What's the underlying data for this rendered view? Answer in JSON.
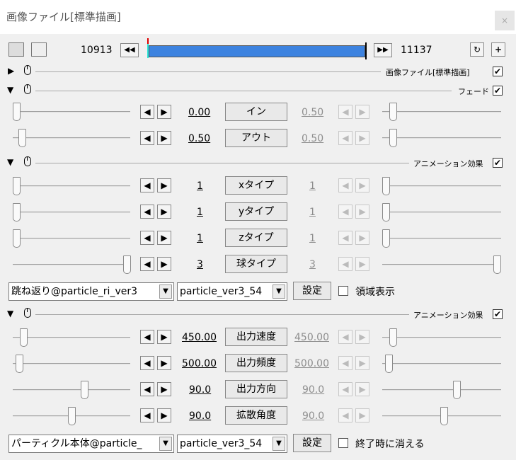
{
  "window": {
    "title": "画像ファイル[標準描画]",
    "close_icon": "close-icon"
  },
  "frames": {
    "start": "10913",
    "end": "11137"
  },
  "header_sections": [
    {
      "label": "画像ファイル[標準描画]",
      "checked": true
    }
  ],
  "fade_section": {
    "label": "フェード",
    "rows": [
      {
        "left": "0.00",
        "button": "イン",
        "right": "0.50"
      },
      {
        "left": "0.50",
        "button": "アウト",
        "right": "0.50"
      }
    ]
  },
  "anim1": {
    "label": "アニメーション効果",
    "rows": [
      {
        "left": "1",
        "button": "xタイプ",
        "right": "1"
      },
      {
        "left": "1",
        "button": "yタイプ",
        "right": "1"
      },
      {
        "left": "1",
        "button": "zタイプ",
        "right": "1"
      },
      {
        "left": "3",
        "button": "球タイプ",
        "right": "3"
      }
    ],
    "select1": "跳ね返り@particle_ri_ver3",
    "select2": "particle_ver3_54",
    "settings_button": "設定",
    "checkbox_label": "領域表示"
  },
  "anim2": {
    "label": "アニメーション効果",
    "rows": [
      {
        "left": "450.00",
        "button": "出力速度",
        "right": "450.00"
      },
      {
        "left": "500.00",
        "button": "出力頻度",
        "right": "500.00"
      },
      {
        "left": "90.0",
        "button": "出力方向",
        "right": "90.0"
      },
      {
        "left": "90.0",
        "button": "拡散角度",
        "right": "90.0"
      }
    ],
    "select1": "パーティクル本体@particle_",
    "select2": "particle_ver3_54",
    "settings_button": "設定",
    "checkbox_label": "終了時に消える"
  },
  "glyphs": {
    "left_arrow": "◀",
    "right_arrow": "▶",
    "check": "✔",
    "down_arrow": "▼",
    "expanded": "▼",
    "collapsed": "▶",
    "prev": "◀◀",
    "next": "▶▶",
    "plus": "+",
    "loop": "↻",
    "close": "×"
  },
  "slider_levels": {
    "fade_row1": [
      0.0,
      0.05
    ],
    "fade_row2": [
      0.05,
      0.05
    ],
    "anim1_rows": [
      [
        0,
        0
      ],
      [
        0,
        0
      ],
      [
        0,
        0
      ],
      [
        1,
        1
      ]
    ],
    "anim2_rows": [
      [
        0.07,
        0.07
      ],
      [
        0.05,
        0.03
      ],
      [
        0.6,
        0.6
      ],
      [
        0.5,
        0.5
      ]
    ]
  }
}
